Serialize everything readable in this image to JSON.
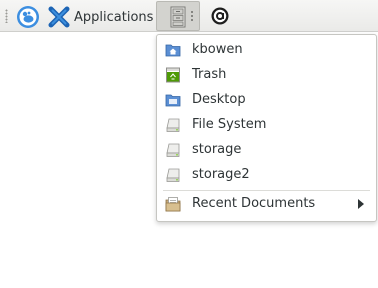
{
  "panel": {
    "applications_label": "Applications"
  },
  "places_menu": {
    "items": [
      {
        "label": "kbowen",
        "icon": "home-folder-icon"
      },
      {
        "label": "Trash",
        "icon": "trash-icon"
      },
      {
        "label": "Desktop",
        "icon": "desktop-folder-icon"
      },
      {
        "label": "File System",
        "icon": "drive-icon"
      },
      {
        "label": "storage",
        "icon": "drive-icon"
      },
      {
        "label": "storage2",
        "icon": "drive-icon"
      }
    ],
    "recent": {
      "label": "Recent Documents",
      "icon": "recent-documents-icon"
    }
  },
  "colors": {
    "panel_bg": "#eeeeec",
    "folder_blue": "#5b8fd4",
    "trash_green": "#4e9a06",
    "text": "#2e3436"
  }
}
